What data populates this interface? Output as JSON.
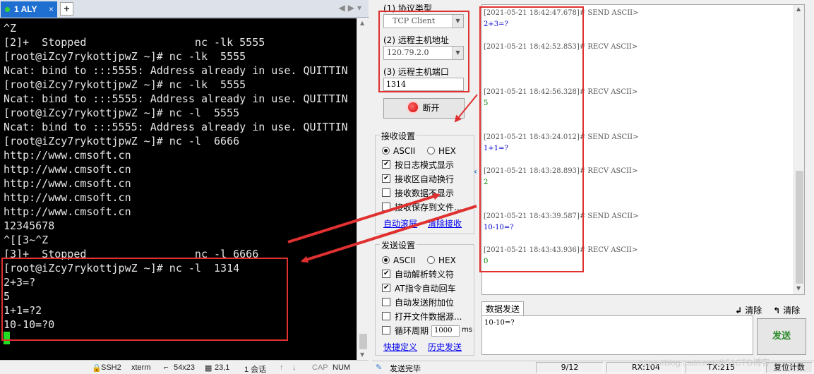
{
  "terminal_window": {
    "tab_label": "1 ALY",
    "tab_close": "×",
    "add_tab": "+",
    "nav_arrows": "◀▶▾",
    "lines": [
      "^Z",
      "[2]+  Stopped                 nc -lk 5555",
      "[root@iZcy7rykottjpwZ ~]# nc -lk  5555",
      "Ncat: bind to :::5555: Address already in use. QUITTIN",
      "[root@iZcy7rykottjpwZ ~]# nc -lk  5555",
      "Ncat: bind to :::5555: Address already in use. QUITTIN",
      "[root@iZcy7rykottjpwZ ~]# nc -l  5555",
      "Ncat: bind to :::5555: Address already in use. QUITTIN",
      "[root@iZcy7rykottjpwZ ~]# nc -l  6666",
      "http://www.cmsoft.cn",
      "http://www.cmsoft.cn",
      "http://www.cmsoft.cn",
      "http://www.cmsoft.cn",
      "http://www.cmsoft.cn",
      "12345678",
      "^[[3~^Z",
      "[3]+  Stopped                 nc -l 6666",
      "[root@iZcy7rykottjpwZ ~]# nc -l  1314",
      "2+3=?",
      "5",
      "1+1=?2",
      "10-10=?0"
    ],
    "status": {
      "ssh": "SSH2",
      "term": "xterm",
      "size": "54x23",
      "pos": "23,1",
      "sessions": "1 会话",
      "cap": "CAP",
      "num": "NUM"
    }
  },
  "app": {
    "protocol_label": "(1) 协议类型",
    "protocol_value": "TCP Client",
    "host_label": "(2) 远程主机地址",
    "host_value": "120.79.2.0",
    "port_label": "(3) 远程主机端口",
    "port_value": "1314",
    "disconnect_label": "断开",
    "recv_settings_title": "接收设置",
    "recv_ascii": "ASCII",
    "recv_hex": "HEX",
    "recv_options": [
      "按日志模式显示",
      "接收区自动换行",
      "接收数据不显示",
      "接收保存到文件..."
    ],
    "recv_checked": [
      true,
      true,
      false,
      false
    ],
    "auto_save_link": "自动滚屏",
    "clear_recv_link": "清除接收",
    "send_settings_title": "发送设置",
    "send_ascii": "ASCII",
    "send_hex": "HEX",
    "send_options": [
      "自动解析转义符",
      "AT指令自动回车",
      "自动发送附加位",
      "打开文件数据源...",
      "循环周期"
    ],
    "send_checked": [
      true,
      true,
      false,
      false,
      false
    ],
    "loop_period_value": "1000",
    "loop_unit": "ms",
    "shortcut_link": "快捷定义",
    "history_link": "历史发送",
    "log_entries": [
      {
        "ts": "[2021-05-21 18:42:47.678]# SEND ASCII>",
        "data": "2+3=?",
        "type": "send"
      },
      {
        "ts": "[2021-05-21 18:42:52.853]# RECV ASCII>",
        "data": "",
        "type": "recv"
      },
      {
        "ts": "[2021-05-21 18:42:56.328]# RECV ASCII>",
        "data": "5",
        "type": "recv"
      },
      {
        "ts": "[2021-05-21 18:43:24.012]# SEND ASCII>",
        "data": "1+1=?",
        "type": "send"
      },
      {
        "ts": "[2021-05-21 18:43:28.893]# RECV ASCII>",
        "data": "2",
        "type": "recv"
      },
      {
        "ts": "[2021-05-21 18:43:39.587]# SEND ASCII>",
        "data": "10-10=?",
        "type": "send"
      },
      {
        "ts": "[2021-05-21 18:43:43.936]# RECV ASCII>",
        "data": "0",
        "type": "recv"
      }
    ],
    "send_tab_label": "数据发送",
    "clear_label_1": "清除",
    "clear_label_2": "清除",
    "send_text": "10-10=?",
    "send_button": "发送",
    "status_label": "发送完毕",
    "status_count": "9/12",
    "rx": "RX:104",
    "tx": "TX:215",
    "reset_count": "复位计数"
  },
  "colors": {
    "send_text": "#0000cc",
    "recv_text": "#008000",
    "annotation": "#e03030"
  },
  "watermark": "https://blog.csdn.net/@51CTO博客"
}
